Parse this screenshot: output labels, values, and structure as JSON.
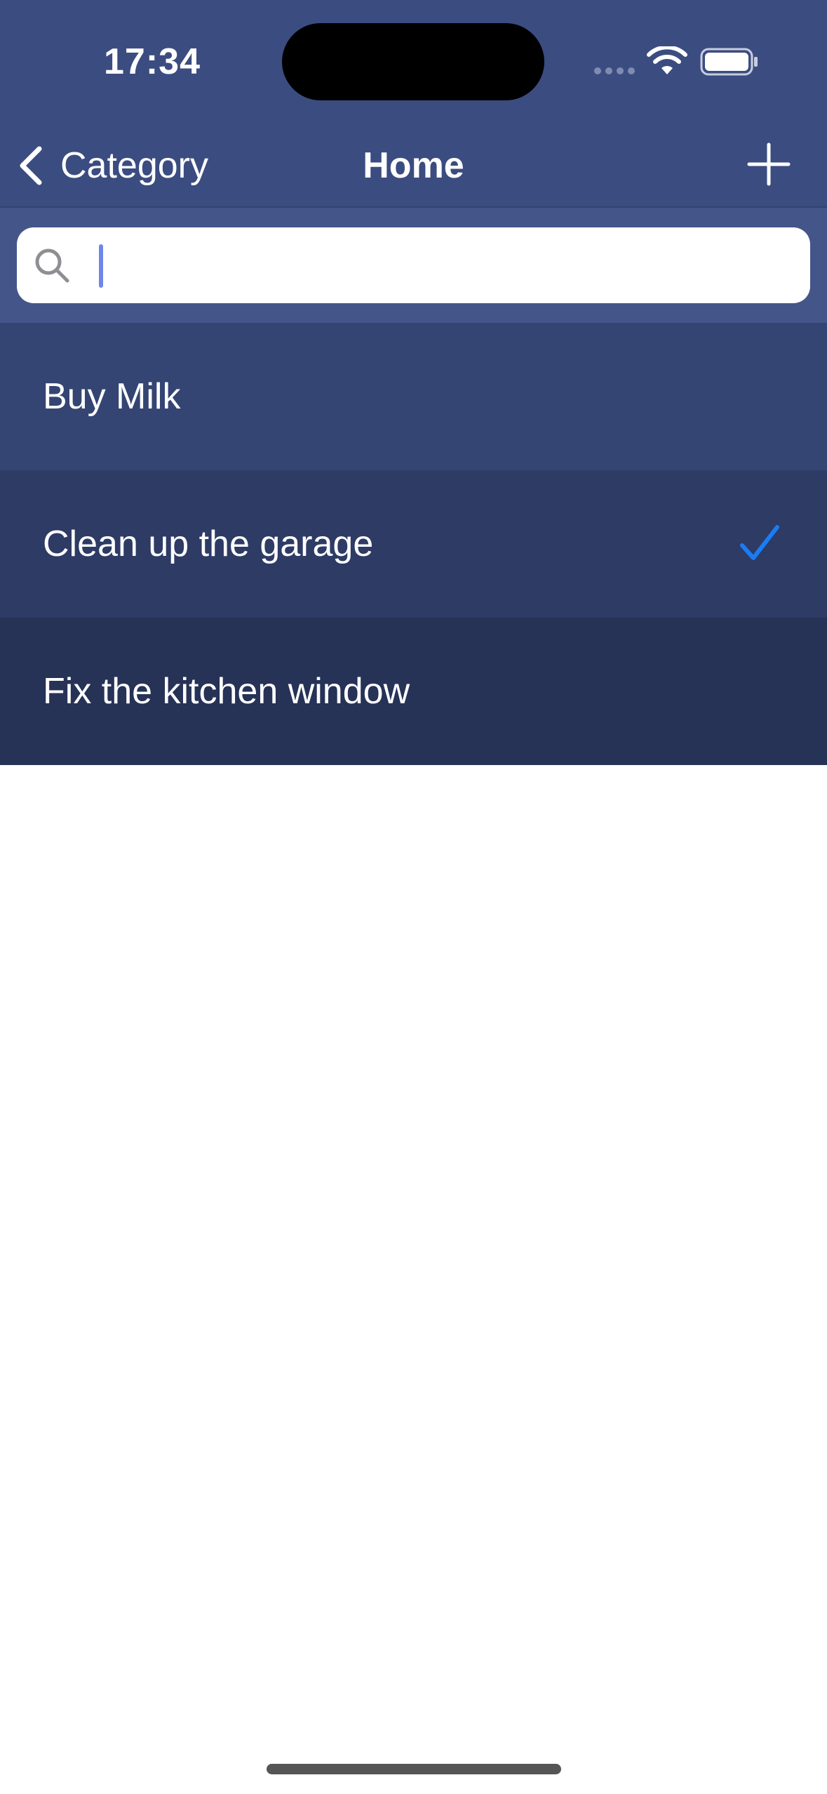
{
  "status_bar": {
    "time": "17:34"
  },
  "nav": {
    "back_label": "Category",
    "title": "Home",
    "add_icon": "plus-icon",
    "back_icon": "chevron-left-icon"
  },
  "search": {
    "value": "",
    "placeholder": "",
    "icon": "search-icon"
  },
  "items": [
    {
      "title": "Buy Milk",
      "done": false,
      "background": "#344573"
    },
    {
      "title": "Clean up the garage",
      "done": true,
      "background": "#2d3b65"
    },
    {
      "title": "Fix the kitchen window",
      "done": false,
      "background": "#263256"
    }
  ],
  "colors": {
    "nav_background": "#3b4c80",
    "search_background": "#44558a",
    "checkmark": "#1a7cf5",
    "text": "#ffffff"
  }
}
